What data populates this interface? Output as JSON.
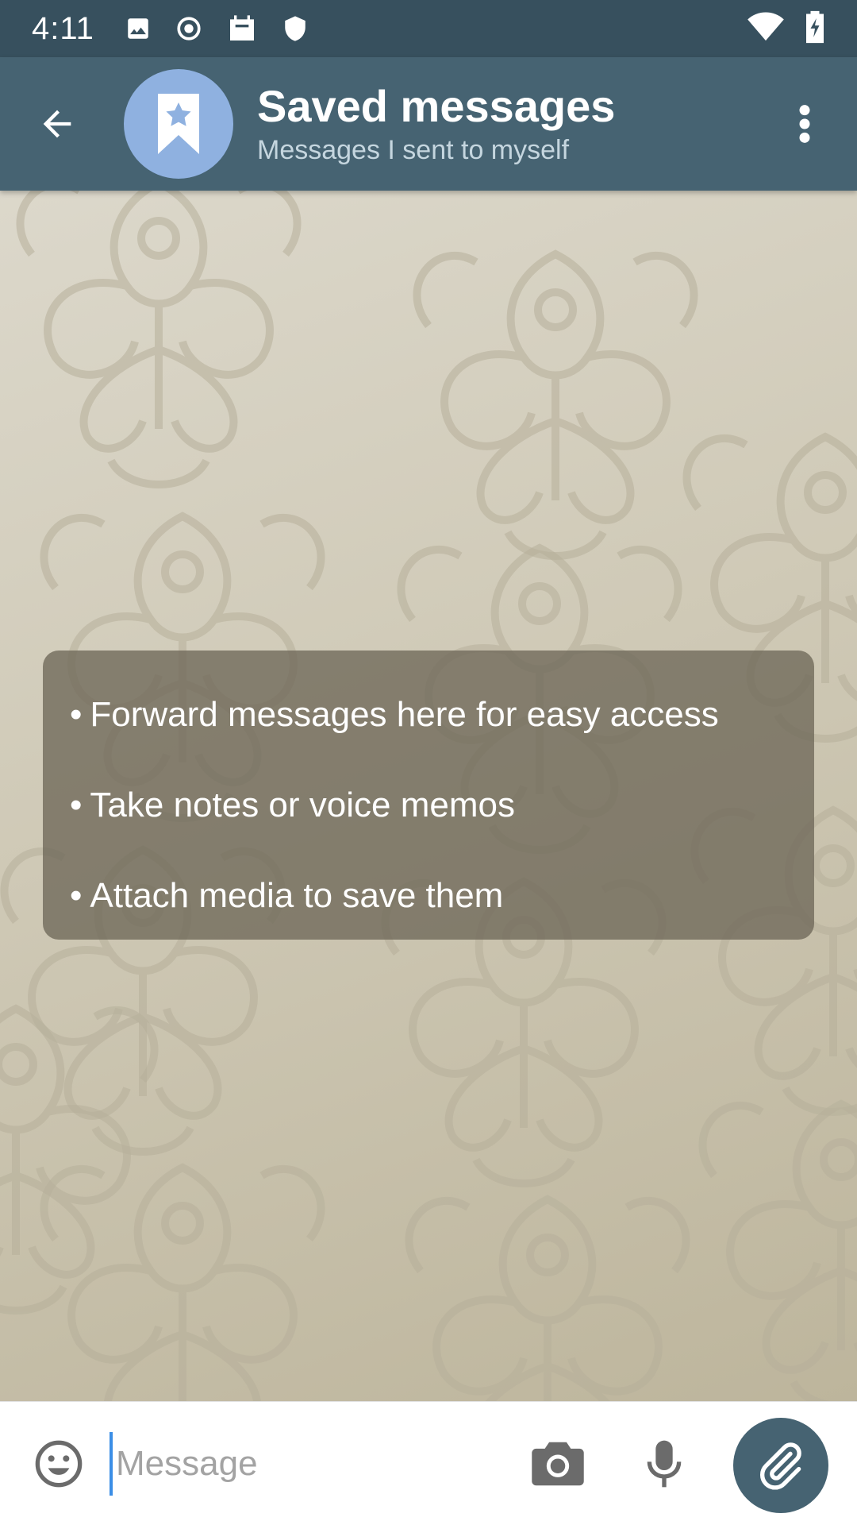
{
  "status_bar": {
    "time": "4:11",
    "icons": [
      "image-icon",
      "record-icon",
      "calendar-icon",
      "shield-icon",
      "wifi-icon",
      "battery-icon"
    ]
  },
  "toolbar": {
    "title": "Saved messages",
    "subtitle": "Messages I sent to myself",
    "icons": [
      "back-arrow-icon",
      "bookmark-star-icon",
      "more-vert-icon"
    ]
  },
  "info_card": {
    "items": [
      "Forward messages here for easy access",
      "Take notes or voice memos",
      "Attach media to save them"
    ]
  },
  "composer": {
    "placeholder": "Message",
    "value": "",
    "icons": [
      "emoji-icon",
      "camera-icon",
      "mic-icon",
      "attach-icon"
    ]
  },
  "colors": {
    "status_bar": "#37505e",
    "toolbar": "#466372",
    "avatar": "#8fb1e0",
    "card": "#6e6858",
    "accent_cursor": "#3b8ee6",
    "icon_gray": "#6b6b6b"
  }
}
